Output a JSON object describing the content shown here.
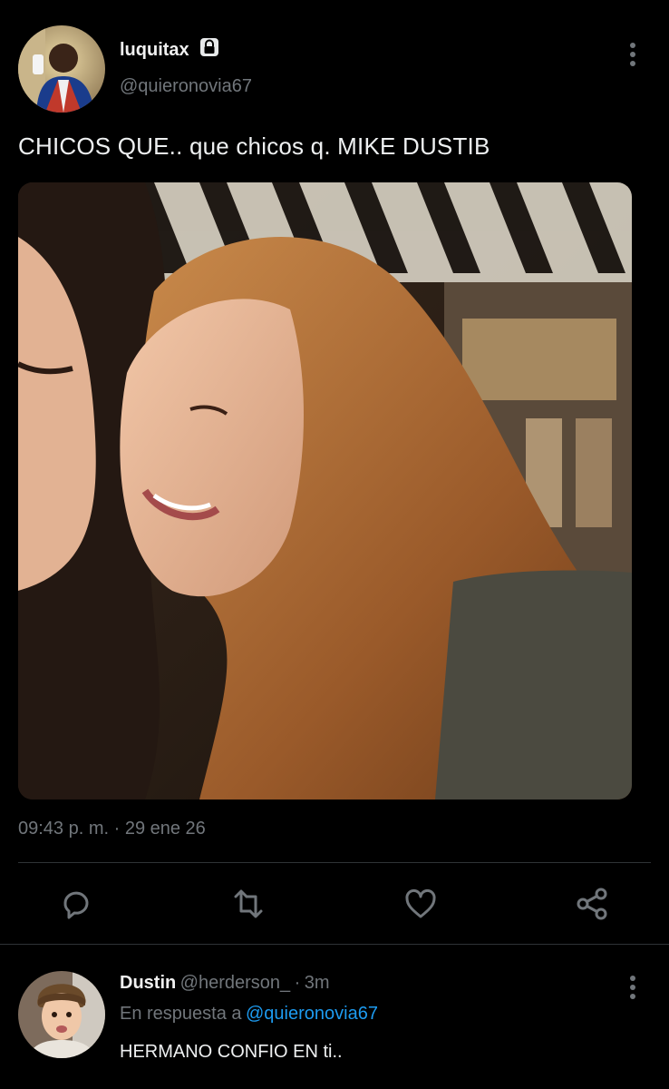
{
  "tweet": {
    "display_name": "luquitax",
    "handle": "@quieronovia67",
    "text": "CHICOS QUE.. que chicos q. MIKE DUSTIB",
    "timestamp": "09:43 p. m. · 29 ene 26",
    "verified_icon": "lock-icon"
  },
  "actions": [
    {
      "name": "reply-icon"
    },
    {
      "name": "retweet-icon"
    },
    {
      "name": "like-icon"
    },
    {
      "name": "share-icon"
    }
  ],
  "reply": {
    "display_name": "Dustin",
    "handle": "@herderson_",
    "separator": "·",
    "time_ago": "3m",
    "in_reply_prefix": "En respuesta a",
    "in_reply_handle": "@quieronovia67",
    "text": "HERMANO CONFIO EN ti.."
  },
  "colors": {
    "background": "#000000",
    "text": "#e7e9ea",
    "muted": "#71767b",
    "link": "#1d9bf0",
    "divider": "#2f3336"
  }
}
